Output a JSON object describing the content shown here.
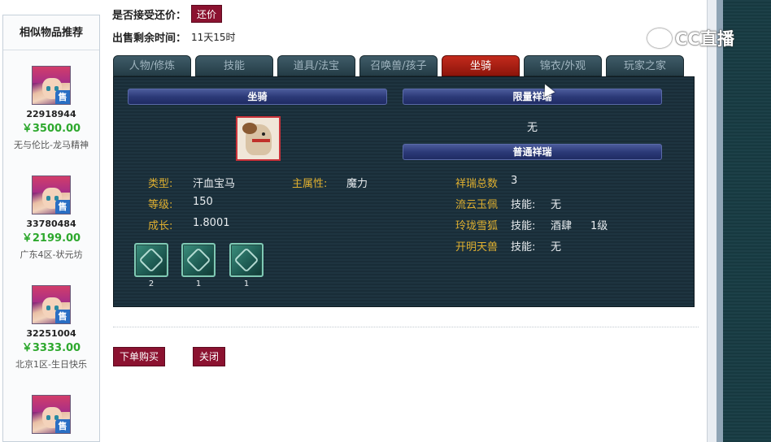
{
  "top_info": {
    "counter_offer_label": "是否接受还价：",
    "counter_offer_button": "还价",
    "time_left_label": "出售剩余时间：",
    "time_left_value": "11天15时"
  },
  "watermark": "CC直播",
  "sidebar": {
    "title": "相似物品推荐",
    "sale_badge": "售",
    "items": [
      {
        "id": "22918944",
        "price": "￥3500.00",
        "server": "无与伦比-龙马精神"
      },
      {
        "id": "33780484",
        "price": "￥2199.00",
        "server": "广东4区-状元坊"
      },
      {
        "id": "32251004",
        "price": "￥3333.00",
        "server": "北京1区-生日快乐"
      },
      {
        "id": "",
        "price": "",
        "server": ""
      }
    ]
  },
  "tabs": [
    {
      "label": "人物/修炼",
      "active": false
    },
    {
      "label": "技能",
      "active": false
    },
    {
      "label": "道具/法宝",
      "active": false
    },
    {
      "label": "召唤兽/孩子",
      "active": false
    },
    {
      "label": "坐骑",
      "active": true
    },
    {
      "label": "锦衣/外观",
      "active": false
    },
    {
      "label": "玩家之家",
      "active": false
    }
  ],
  "mount_panel": {
    "header": "坐骑",
    "type_label": "类型:",
    "type_value": "汗血宝马",
    "main_attr_label": "主属性:",
    "main_attr_value": "魔力",
    "level_label": "等级:",
    "level_value": "150",
    "growth_label": "成长:",
    "growth_value": "1.8001",
    "skills": [
      {
        "icon": "mount-skill-1-icon",
        "count": "2"
      },
      {
        "icon": "mount-skill-2-icon",
        "count": "1"
      },
      {
        "icon": "mount-skill-3-icon",
        "count": "1"
      }
    ]
  },
  "xiangrui_panel": {
    "limited_header": "限量祥瑞",
    "limited_value": "无",
    "normal_header": "普通祥瑞",
    "total_label": "祥瑞总数",
    "total_value": "3",
    "entries": [
      {
        "name": "流云玉佩",
        "skill_label": "技能:",
        "skill_value": "无",
        "level": ""
      },
      {
        "name": "玲珑雪狐",
        "skill_label": "技能:",
        "skill_value": "酒肆",
        "level": "1级"
      },
      {
        "name": "开明天兽",
        "skill_label": "技能:",
        "skill_value": "无",
        "level": ""
      }
    ]
  },
  "actions": {
    "buy_label": "下单购买",
    "close_label": "关闭"
  },
  "colors": {
    "accent_red": "#8b1230",
    "price_green": "#2da82d",
    "attr_gold": "#e0b030",
    "panel_bg": "#1e3440",
    "tab_active": "#c32a1c"
  }
}
